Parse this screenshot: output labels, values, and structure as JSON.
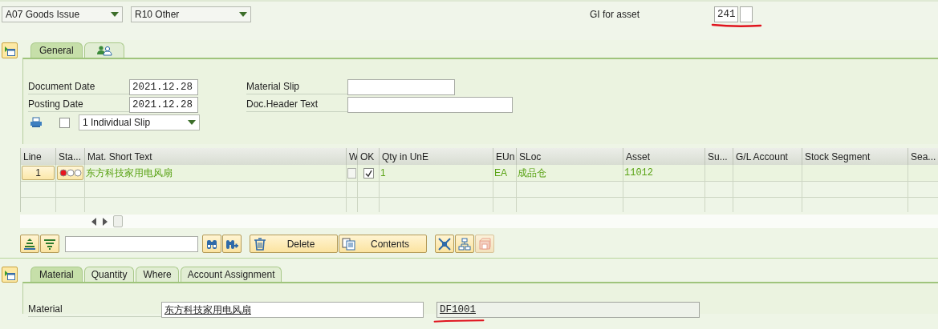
{
  "header": {
    "movement_type": "A07 Goods Issue",
    "reason": "R10 Other",
    "gi_for_asset_label": "GI for asset",
    "gi_for_asset_value": "241",
    "gi_for_asset_underlined": true
  },
  "header_tabs": [
    {
      "kind": "text",
      "label": "General",
      "selected": true
    },
    {
      "kind": "icon",
      "selected": false
    }
  ],
  "general": {
    "document_date_label": "Document Date",
    "document_date": "2021.12.28",
    "posting_date_label": "Posting Date",
    "posting_date": "2021.12.28",
    "material_slip_label": "Material Slip",
    "doc_header_text_label": "Doc.Header Text",
    "print_checked": false,
    "print_version": "1 Individual Slip"
  },
  "items_table": {
    "columns": [
      "Line",
      "Sta...",
      "Mat. Short Text",
      "W",
      "OK",
      "Qty in UnE",
      "EUn",
      "SLoc",
      "Asset",
      "Su...",
      "G/L Account",
      "Stock Segment",
      "Sea..."
    ],
    "rows": [
      {
        "line": "1",
        "status_lights": [
          {
            "on": true
          },
          {
            "on": false
          },
          {
            "on": false
          }
        ],
        "text": "东方科技家用电风扇",
        "w_checked": false,
        "ok_checked": true,
        "qty": "1",
        "eun": "EA",
        "sloc": "成品仓",
        "asset": "11012"
      }
    ]
  },
  "toolbar": {
    "delete": "Delete",
    "contents": "Contents"
  },
  "detail_tabs": [
    {
      "label": "Material",
      "selected": true
    },
    {
      "label": "Quantity",
      "selected": false
    },
    {
      "label": "Where",
      "selected": false
    },
    {
      "label": "Account Assignment",
      "selected": false
    }
  ],
  "material": {
    "label": "Material",
    "description": "东方科技家用电风扇",
    "number": "DF1001",
    "number_underlined": true
  }
}
